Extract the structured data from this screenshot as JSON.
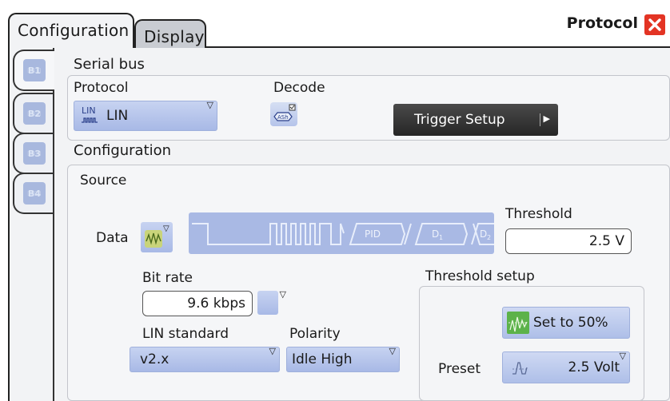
{
  "tabs": {
    "configuration": "Configuration",
    "display": "Display"
  },
  "window": {
    "title": "Protocol",
    "close_icon": "close-icon"
  },
  "bus_tabs": [
    {
      "label": "B1",
      "active": true
    },
    {
      "label": "B2",
      "active": false
    },
    {
      "label": "B3",
      "active": false
    },
    {
      "label": "B4",
      "active": false
    }
  ],
  "serial_bus": {
    "heading": "Serial bus",
    "protocol_label": "Protocol",
    "protocol_value": "LIN",
    "protocol_icon_text": "LIN",
    "decode_label": "Decode",
    "decode_icon_text": "ASh",
    "trigger_setup_label": "Trigger Setup"
  },
  "configuration": {
    "heading": "Configuration",
    "source_label": "Source",
    "data_label": "Data",
    "waveform": {
      "pid": "PID",
      "d1": "D",
      "d1_sub": "1",
      "d2": "D",
      "d2_sub": "2"
    },
    "threshold_label": "Threshold",
    "threshold_value": "2.5 V",
    "bit_rate_label": "Bit rate",
    "bit_rate_value": "9.6 kbps",
    "lin_standard_label": "LIN standard",
    "lin_standard_value": "v2.x",
    "polarity_label": "Polarity",
    "polarity_value": "Idle High",
    "threshold_setup_label": "Threshold setup",
    "set_to_50_label": "Set to 50%",
    "preset_label": "Preset",
    "preset_value": "2.5 Volt"
  },
  "colors": {
    "accent_blue": "#a8b9e6",
    "dark_button": "#2e2e2e",
    "close_red": "#e33424",
    "waveform_bg": "#a9b9e4"
  }
}
